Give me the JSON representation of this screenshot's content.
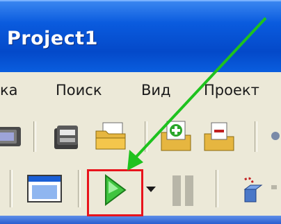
{
  "window": {
    "title": "Project1"
  },
  "menu": {
    "items": [
      {
        "label": "ка"
      },
      {
        "label": "Поиск"
      },
      {
        "label": "Вид"
      },
      {
        "label": "Проект"
      }
    ]
  },
  "toolbar_row1": {
    "icons": [
      "open-project-icon",
      "save-all-icon",
      "open-folder-icon",
      "add-to-project-icon",
      "remove-from-project-icon"
    ]
  },
  "toolbar_row2": {
    "icons": [
      "toggle-form-unit-icon",
      "run-icon",
      "run-dropdown-icon",
      "pause-icon",
      "trace-into-icon"
    ]
  },
  "annotation": {
    "arrow_color": "#1ec21e",
    "highlight_color": "#e8141c"
  },
  "colors": {
    "titlebar": "#0a5bde",
    "toolbar_bg": "#ece9d8",
    "run_green": "#3fc43f"
  }
}
